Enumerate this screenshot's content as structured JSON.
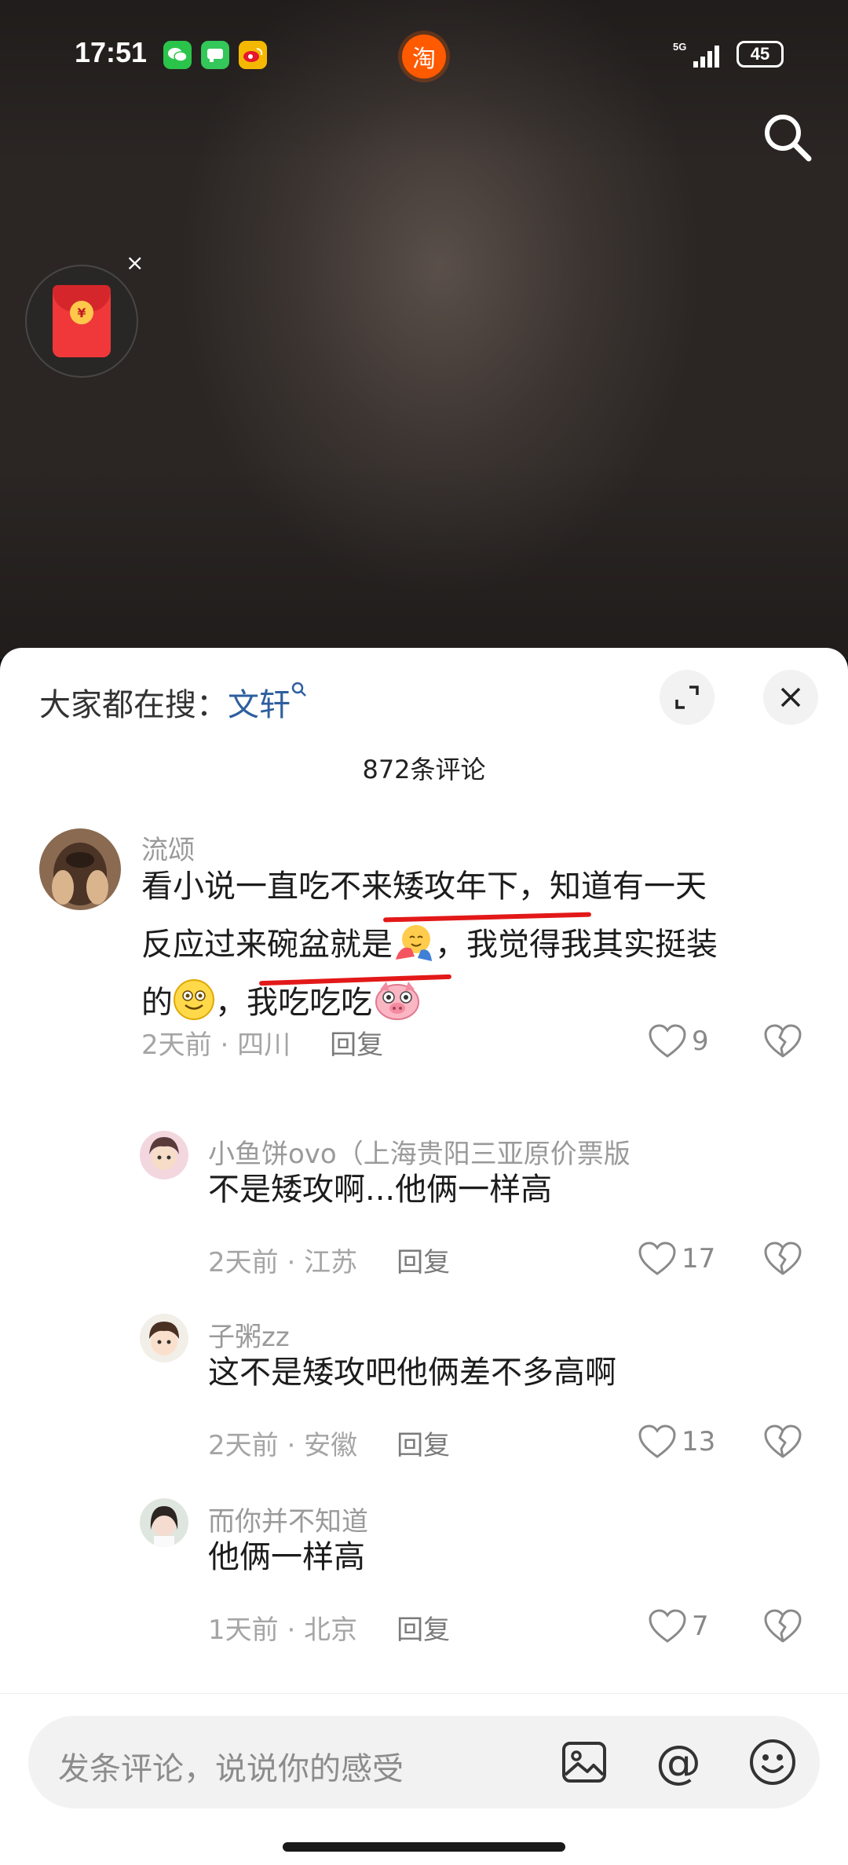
{
  "status_bar": {
    "time": "17:51",
    "network": "5G",
    "battery": "45",
    "center_app_glyph": "淘"
  },
  "floating": {
    "close_glyph": "×",
    "coin_glyph": "¥"
  },
  "sheet": {
    "hot_search_prefix": "大家都在搜：",
    "hot_search_keyword": "文轩",
    "comment_count": "872条评论"
  },
  "comments": [
    {
      "name": "流颂",
      "text_line1": "看小说一直吃不来矮攻年下，知道有一天",
      "text_line2_a": "反应过来碗盆就是",
      "text_line2_b": "，我觉得我其实挺装",
      "text_line3_a": "的",
      "text_line3_b": "，我吃吃吃",
      "time": "2天前",
      "location": "四川",
      "reply": "回复",
      "likes": "9"
    },
    {
      "name": "小鱼饼ovo（上海贵阳三亚原价票版",
      "text": "不是矮攻啊...他俩一样高",
      "time": "2天前",
      "location": "江苏",
      "reply": "回复",
      "likes": "17"
    },
    {
      "name": "子粥zz",
      "text": "这不是矮攻吧他俩差不多高啊",
      "time": "2天前",
      "location": "安徽",
      "reply": "回复",
      "likes": "13"
    },
    {
      "name": "而你并不知道",
      "text": "他俩一样高",
      "time": "1天前",
      "location": "北京",
      "reply": "回复",
      "likes": "7"
    }
  ],
  "input": {
    "placeholder": "发条评论，说说你的感受",
    "at_glyph": "@"
  },
  "meta_sep": " · ",
  "colors": {
    "accent_red": "#e31818",
    "keyword_blue": "#2e5f9e",
    "taobao_orange": "#ff5a00"
  }
}
